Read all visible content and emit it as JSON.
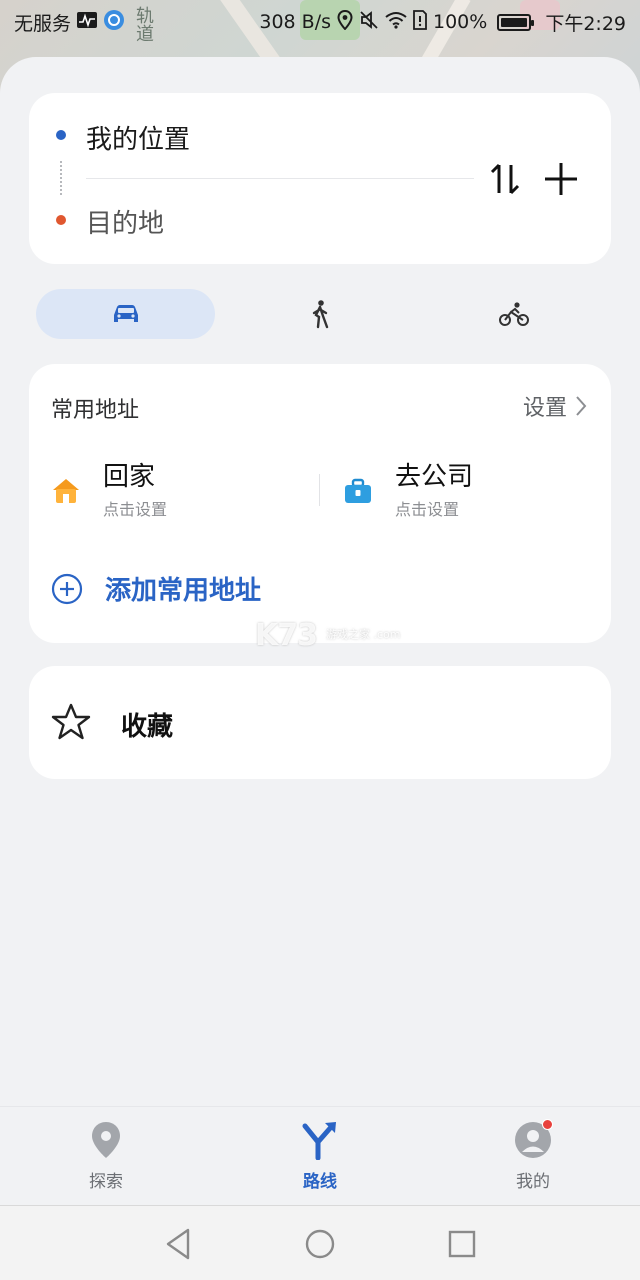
{
  "status_bar": {
    "carrier": "无服务",
    "speed": "308 B/s",
    "battery": "100%",
    "battery_level": 1.0,
    "time": "下午2:29"
  },
  "map": {
    "label": "轨道"
  },
  "route": {
    "origin": "我的位置",
    "destination": "目的地",
    "origin_dot_color": "#2a64c5",
    "destination_dot_color": "#e0572f"
  },
  "modes": [
    {
      "name": "drive",
      "icon": "car-icon",
      "active": true
    },
    {
      "name": "walk",
      "icon": "walk-icon",
      "active": false
    },
    {
      "name": "bike",
      "icon": "bike-icon",
      "active": false
    }
  ],
  "common_address": {
    "title": "常用地址",
    "settings_label": "设置",
    "home": {
      "title": "回家",
      "subtitle": "点击设置",
      "icon": "home-icon"
    },
    "work": {
      "title": "去公司",
      "subtitle": "点击设置",
      "icon": "briefcase-icon"
    },
    "add_label": "添加常用地址"
  },
  "favorites": {
    "label": "收藏",
    "icon": "star-icon"
  },
  "watermark": {
    "text": "K73",
    "sub": "游戏之家 .com"
  },
  "bottom_nav": [
    {
      "label": "探索",
      "icon": "location-pin-icon",
      "active": false
    },
    {
      "label": "路线",
      "icon": "route-icon",
      "active": true
    },
    {
      "label": "我的",
      "icon": "avatar-icon",
      "active": false,
      "badge": true
    }
  ],
  "colors": {
    "accent": "#2a64c5",
    "active_tab_bg": "#dce6f6",
    "badge": "#e8413d"
  }
}
